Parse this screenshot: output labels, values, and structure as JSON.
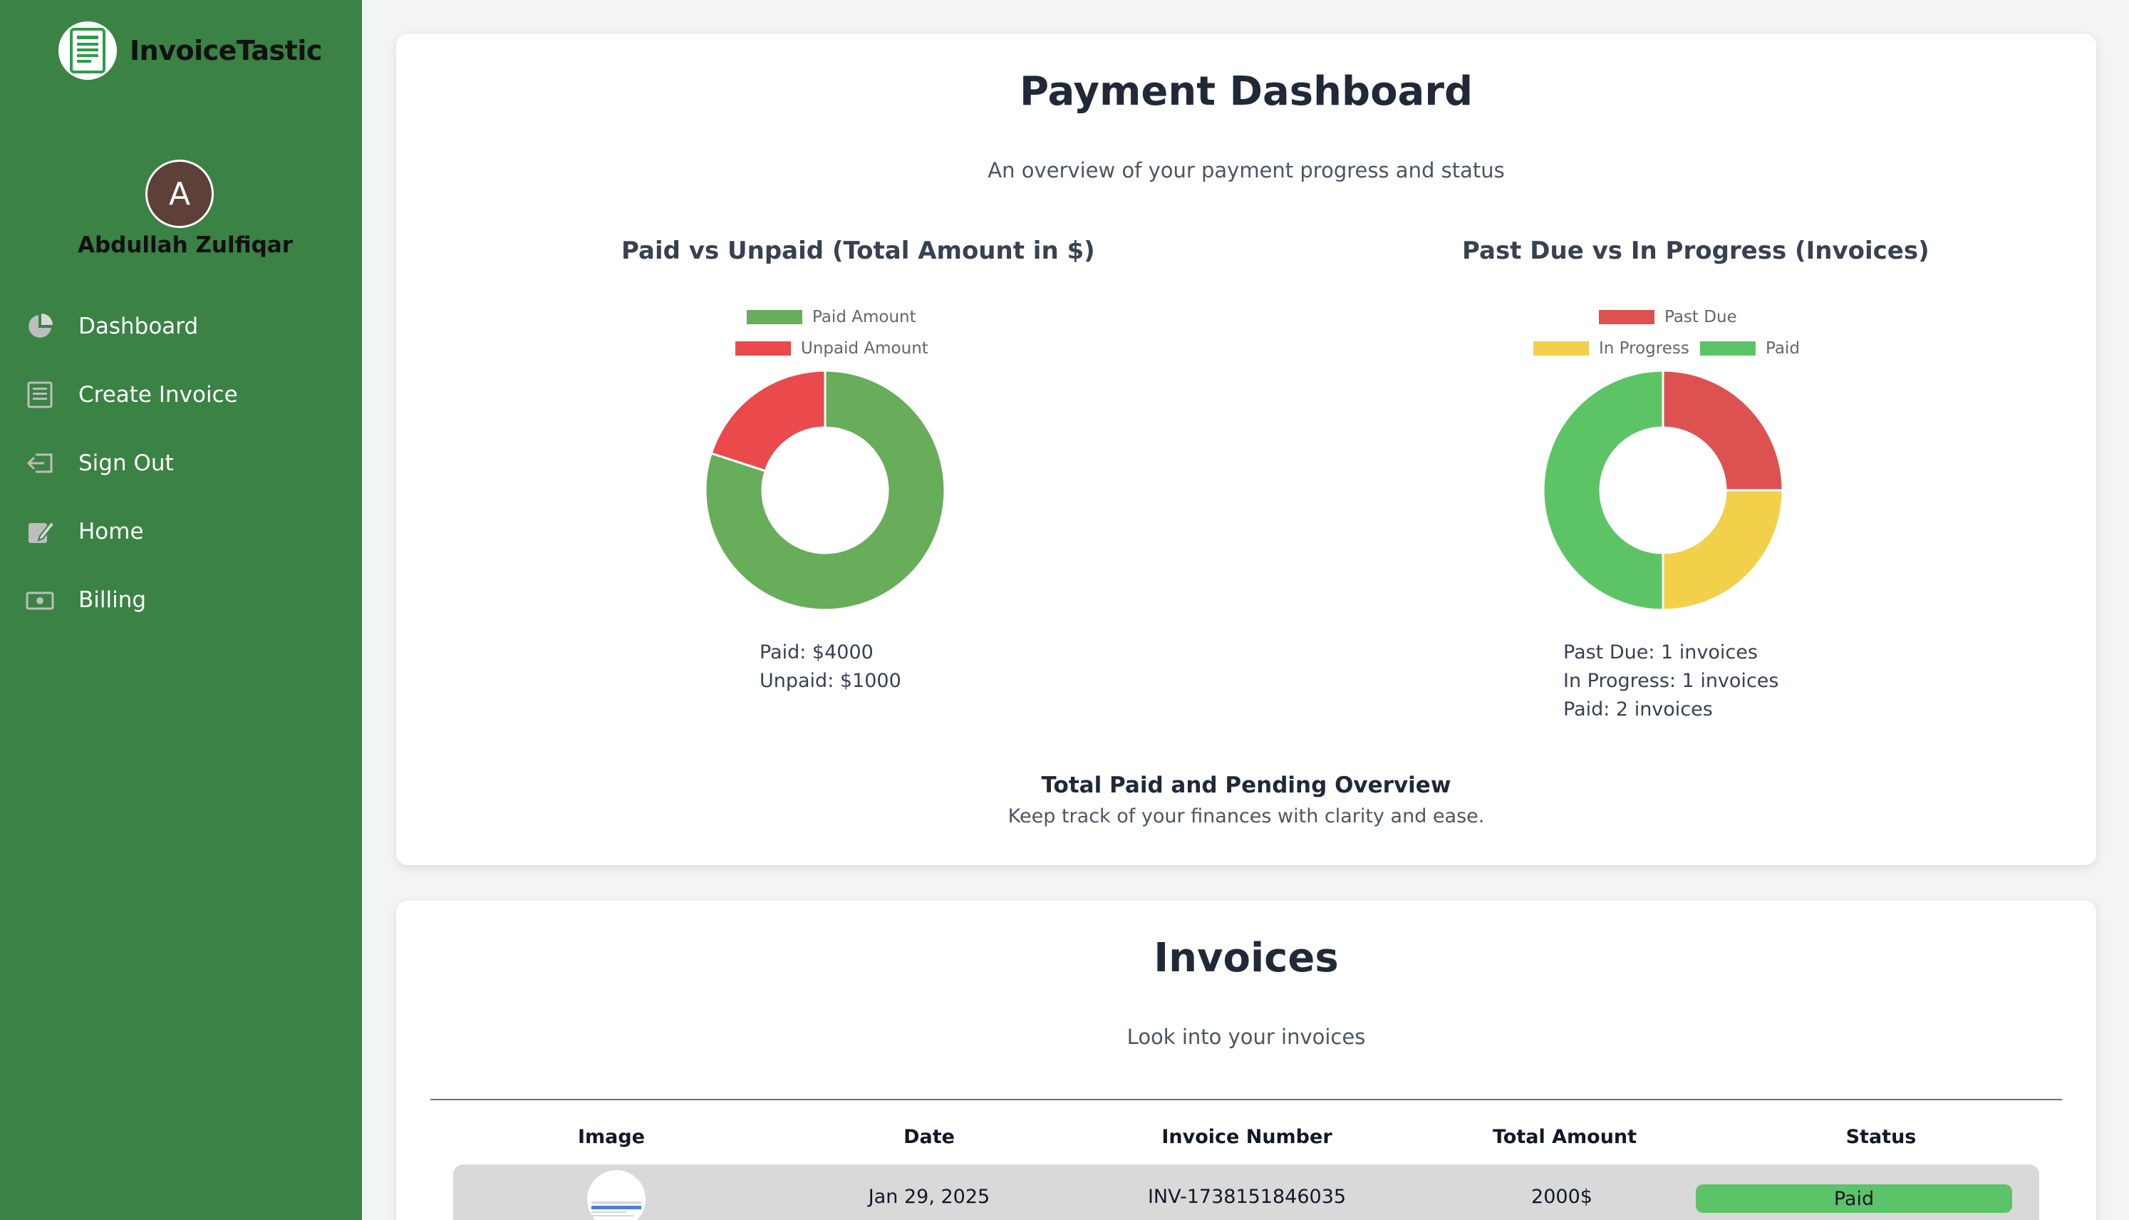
{
  "app": {
    "name": "InvoiceTastic"
  },
  "user": {
    "initial": "A",
    "name": "Abdullah Zulfiqar"
  },
  "sidebar": {
    "items": [
      {
        "label": "Dashboard",
        "icon": "pie-chart-icon"
      },
      {
        "label": "Create Invoice",
        "icon": "document-icon"
      },
      {
        "label": "Sign Out",
        "icon": "sign-out-icon"
      },
      {
        "label": "Home",
        "icon": "edit-icon"
      },
      {
        "label": "Billing",
        "icon": "money-icon"
      }
    ]
  },
  "dashboard": {
    "title": "Payment Dashboard",
    "subtitle": "An overview of your payment progress and status",
    "overview_title": "Total Paid and Pending Overview",
    "overview_subtitle": "Keep track of your finances with clarity and ease."
  },
  "chart_data": [
    {
      "type": "pie",
      "title": "Paid vs Unpaid (Total Amount in $)",
      "categories": [
        "Paid Amount",
        "Unpaid Amount"
      ],
      "values": [
        4000,
        1000
      ],
      "colors": [
        "#68ad5a",
        "#ea4a4c"
      ],
      "legend": "top",
      "summary": [
        "Paid: $4000",
        "Unpaid: $1000"
      ]
    },
    {
      "type": "pie",
      "title": "Past Due vs In Progress (Invoices)",
      "categories": [
        "Past Due",
        "In Progress",
        "Paid"
      ],
      "values": [
        1,
        1,
        2
      ],
      "colors": [
        "#dd5250",
        "#f2d04a",
        "#5dc466"
      ],
      "legend": "top",
      "summary": [
        "Past Due: 1 invoices",
        "In Progress: 1 invoices",
        "Paid: 2 invoices"
      ]
    }
  ],
  "invoices": {
    "title": "Invoices",
    "subtitle": "Look into your invoices",
    "columns": [
      "Image",
      "Date",
      "Invoice Number",
      "Total Amount",
      "Status"
    ],
    "rows": [
      {
        "date": "Jan 29, 2025",
        "number": "INV-1738151846035",
        "amount": "2000$",
        "status": "Paid",
        "status_color": "#5cc468"
      }
    ]
  }
}
